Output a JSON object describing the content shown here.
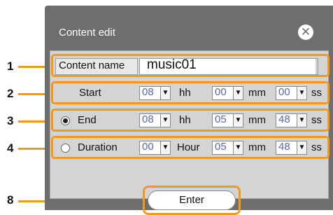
{
  "dialog": {
    "title": "Content edit",
    "close_icon": "close-circle-icon"
  },
  "callouts": [
    "1",
    "2",
    "3",
    "4",
    "8"
  ],
  "content_name": {
    "label": "Content name",
    "value": "music01"
  },
  "start": {
    "label": "Start",
    "hh": "08",
    "hh_unit": "hh",
    "mm": "00",
    "mm_unit": "mm",
    "ss": "00",
    "ss_unit": "ss"
  },
  "end": {
    "label": "End",
    "selected": true,
    "hh": "08",
    "hh_unit": "hh",
    "mm": "05",
    "mm_unit": "mm",
    "ss": "48",
    "ss_unit": "ss"
  },
  "duration": {
    "label": "Duration",
    "selected": false,
    "hour": "00",
    "hour_unit": "Hour",
    "mm": "05",
    "mm_unit": "mm",
    "ss": "48",
    "ss_unit": "ss"
  },
  "enter_label": "Enter",
  "accent": "#f39a1c"
}
